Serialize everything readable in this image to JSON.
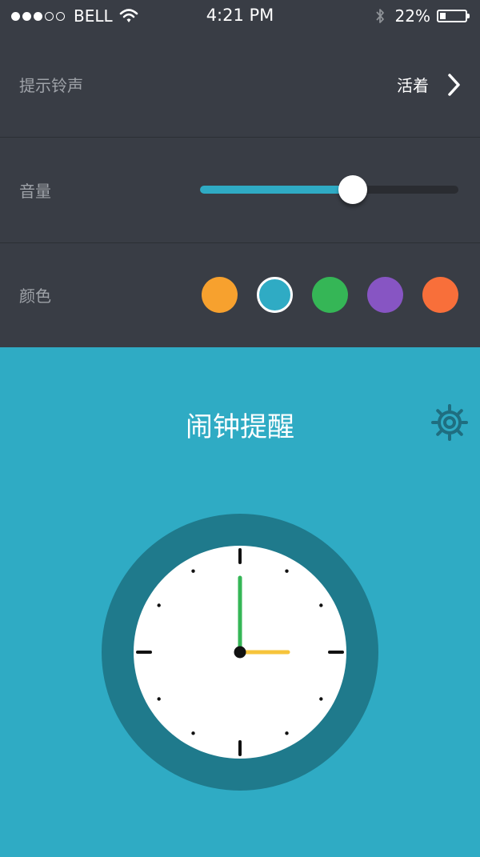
{
  "status_bar": {
    "signal": {
      "filled": 3,
      "total": 5
    },
    "carrier": "BELL",
    "time": "4:21 PM",
    "battery_text": "22%",
    "battery_level": 0.22
  },
  "settings": {
    "ringtone": {
      "label": "提示铃声",
      "value": "活着"
    },
    "volume": {
      "label": "音量",
      "level": 0.59
    },
    "color": {
      "label": "颜色",
      "options": [
        "#f7a12e",
        "#2fabc4",
        "#35b656",
        "#8755c3",
        "#f86f3a"
      ],
      "selected_index": 1
    }
  },
  "alarm": {
    "title": "闹钟提醒",
    "clock": {
      "hour": 3,
      "minute": 0
    },
    "colors": {
      "ring": "#1f7a8c",
      "face": "#ffffff",
      "hour_hand": "#f6c43b",
      "minute_hand": "#35b656"
    }
  },
  "icons": {
    "wifi": "wifi-icon",
    "bluetooth": "bluetooth-icon",
    "chevron": "chevron-right-icon",
    "settings": "gear-icon"
  }
}
